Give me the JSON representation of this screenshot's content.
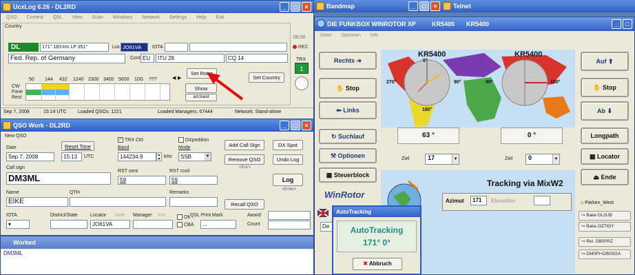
{
  "colors": {
    "titlebar": "#2f5fc6",
    "map_bg": "#c6dff2",
    "continent_green": "#4aa84a",
    "continent_red": "#d9342b",
    "continent_purple": "#7a3ab0",
    "continent_yellow": "#e8d92a",
    "continent_orange": "#e87a1a",
    "rec": "#d92020",
    "dl_green": "#1e8a2e",
    "arrow": "#e01010"
  },
  "ucxlog": {
    "title": "UcxLog 6.26 - DL2RD",
    "menu": [
      "QSO",
      "Contest",
      "QSL",
      "View",
      "Scan",
      "Windows",
      "Network",
      "Settings",
      "Help",
      "Exit"
    ],
    "country_label": "Country",
    "prefix": "DL",
    "bearing": "171° 183 km LP 351°",
    "loc_label": "Loc",
    "locator": "JO61VA",
    "iota_label": "IOTA",
    "country_name": "Fed. Rep. of Germany",
    "cont_label": "Cont",
    "cont": "EU",
    "itu": "ITU 28",
    "cq": "CQ 14",
    "rec_time": "00:00",
    "rec_label": "REC",
    "trx_label": "TRX",
    "trx_value": "1",
    "set_rotor": "Set Rotor",
    "set_country": "Set Country",
    "show_btn": "Show",
    "act_band_btn": "act.band",
    "bands": [
      "50",
      "144",
      "432",
      "1240",
      "2300",
      "3400",
      "5600",
      "10G",
      "???"
    ],
    "modes": [
      "CW",
      "Fone",
      "Rest"
    ],
    "status_date": "Sep 7, 2008",
    "status_time": "15:14 UTC",
    "status_qsos": "Loaded QSOs: 1221",
    "status_managers": "Loaded Managers: 67444",
    "status_network": "Network: Stand-alone"
  },
  "qso": {
    "title": "QSO Work - DL2RD",
    "new_qso": "New QSO",
    "date_label": "Date",
    "date": "Sep 7, 2008",
    "reset_time": "Reset Time",
    "time": "15:13",
    "utc": "UTC",
    "trx_ctrl": "TRX Ctrl",
    "band_label": "Band",
    "freq": "144234.9",
    "khz": "kHz",
    "dxpedition": "DXpedition",
    "mode_label": "Mode",
    "mode": "SSB",
    "add_call": "Add Call Sign",
    "dx_spot": "DX Spot",
    "remove_qso": "Remove QSO",
    "esc": "<Esc>",
    "undo_log": "Undo Log",
    "callsign_label": "Call sign",
    "callsign": "DM3ML",
    "rst_sent_label": "RST sent",
    "rst_sent": "59",
    "rst_rcvd_label": "RST rcvd",
    "rst_rcvd": "59",
    "recall_qso": "Recall QSO",
    "log": "Log",
    "enter": "<Enter>",
    "name_label": "Name",
    "name": "EIKE",
    "qth_label": "QTH",
    "remarks_label": "Remarks",
    "iota_label": "IOTA",
    "district_label": "District/State",
    "locator_label": "Locator",
    "note": "Note",
    "manager_label": "Manager",
    "info": "Info",
    "qsl_print": "QSL Print Mark",
    "award_label": "Award",
    "count_label": "Count",
    "locator": "JO61VA",
    "ok": "Ok",
    "cba": "CBA",
    "qsl_value": "..."
  },
  "worked": {
    "title": "Worked",
    "entry": "DM3ML"
  },
  "bandmap": {
    "title": "Bandmap"
  },
  "telnet": {
    "title": "Telnet"
  },
  "rotor": {
    "title": "DIE FUNKBOX WINROTOR XP",
    "call1": "KR5400",
    "call2": "KR5400",
    "menu": [
      "Datei",
      "Optionen",
      "Info"
    ],
    "rechts": "Rechts",
    "stop_left": "Stop",
    "links": "Links",
    "suchlauf": "Suchlauf",
    "optionen": "Optionen",
    "steuerblock": "Steuerblock",
    "auf": "Auf",
    "stop_right": "Stop",
    "ab": "Ab",
    "longpath": "Longpath",
    "locator": "Locator",
    "ende": "Ende",
    "globe_left_label": "KR5400",
    "globe_right_label": "KR5400",
    "deg_0": "0°",
    "deg_90": "90°",
    "deg_180": "180°",
    "deg_270": "270°",
    "az_value": "63",
    "el_value": "0",
    "deg_unit": "°",
    "ziel": "Ziel",
    "ziel_left": "17",
    "ziel_right": "0",
    "tracking": "Tracking via MixW2",
    "azimut_label": "Azimut",
    "azimut_value": "171",
    "elevation_label": "Elevation",
    "logo": "WinRotor",
    "de_prefix": "De",
    "beacons": [
      "Parken_West",
      "Bake DL0UB",
      "Bake OZ7IGY",
      "Rel. DB0PRZ",
      "DM0PI+DB0SGA"
    ]
  },
  "autotracking": {
    "title": "AutoTracking",
    "heading": "AutoTracking",
    "az": "171°",
    "el": "0°",
    "abbruch": "Abbruch"
  }
}
